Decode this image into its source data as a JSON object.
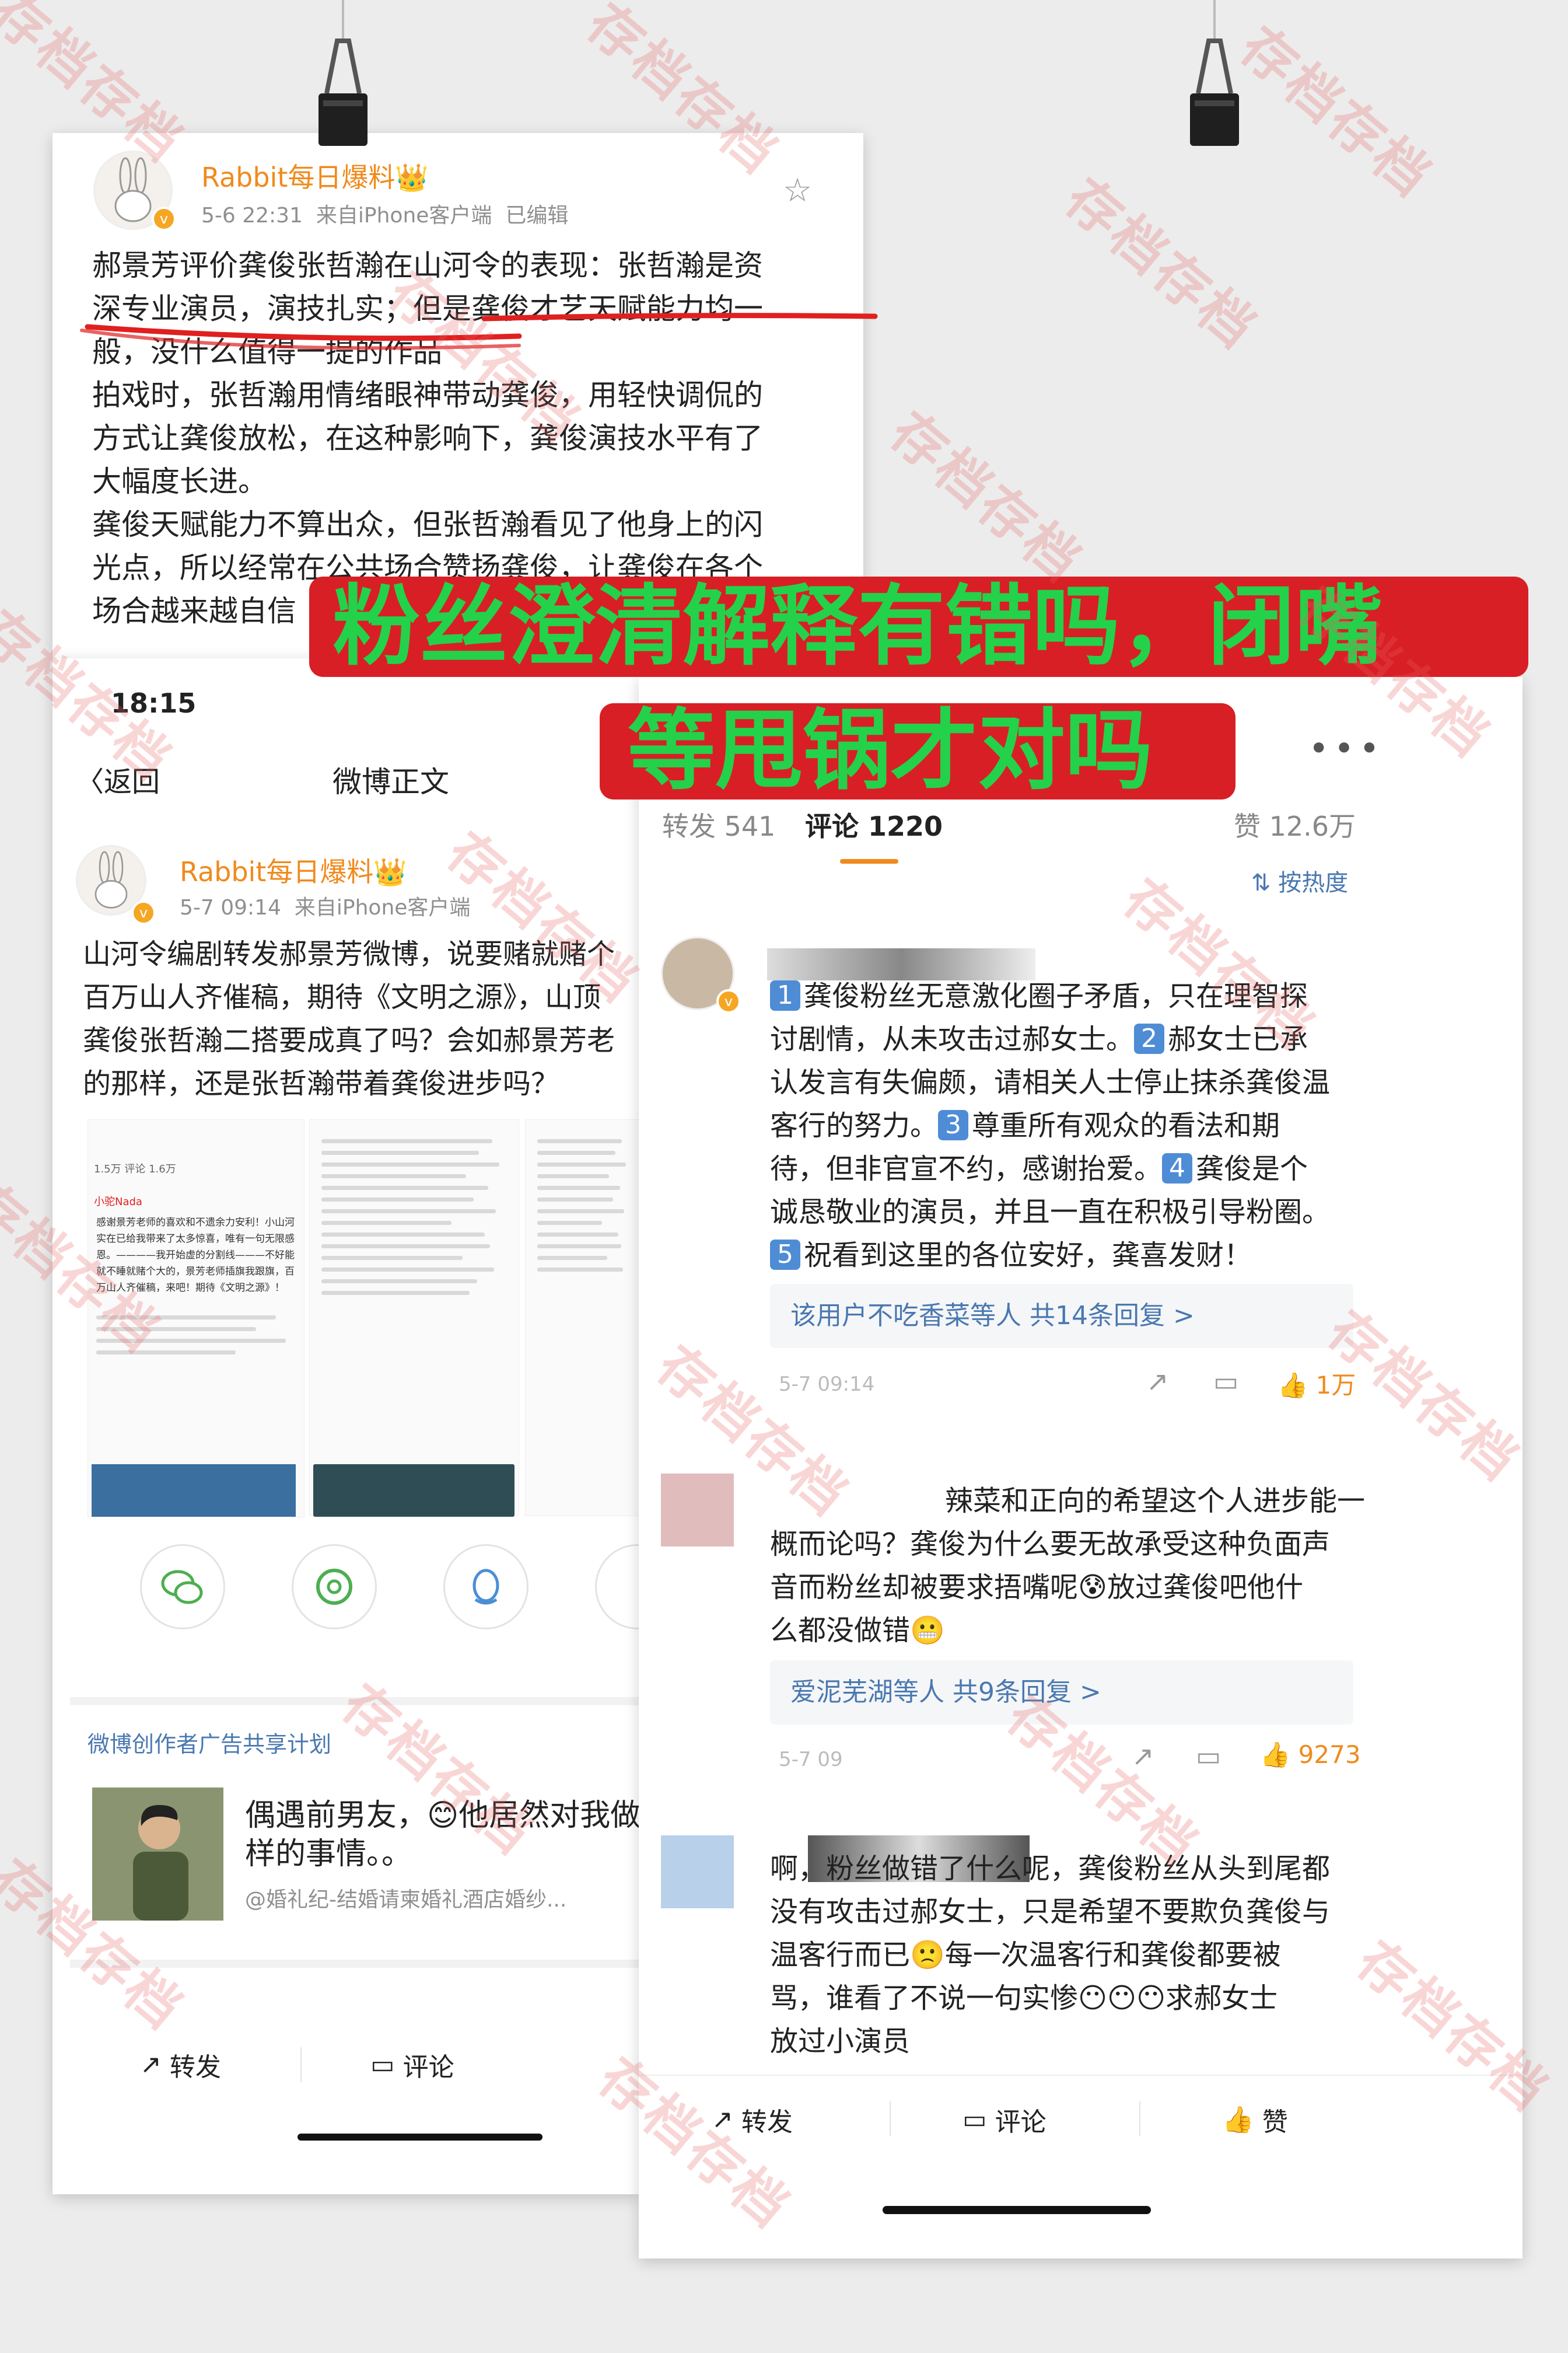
{
  "post1": {
    "user": "Rabbit每日爆料",
    "crown": "👑",
    "meta_time": "5-6 22:31",
    "meta_source": "来自iPhone客户端",
    "meta_edit": "已编辑",
    "body_lines": [
      "郝景芳评价龚俊张哲瀚在山河令的表现：张哲瀚是资",
      "深专业演员，演技扎实；但是龚俊才艺天赋能力均一",
      "般，没什么值得一提的作品",
      "拍戏时，张哲瀚用情绪眼神带动龚俊，用轻快调侃的",
      "方式让龚俊放松，在这种影响下，龚俊演技水平有了",
      "大幅度长进。",
      "龚俊天赋能力不算出众，但张哲瀚看见了他身上的闪",
      "光点，所以经常在公共场合赞扬龚俊，让龚俊在各个",
      "场合越来越自信"
    ]
  },
  "banner": {
    "line1": "粉丝澄清解释有错吗，闭嘴",
    "line2": "等甩锅才对吗"
  },
  "phone_left": {
    "status_time": "18:15",
    "back": "返回",
    "title": "微博正文",
    "user": "Rabbit每日爆料",
    "meta_time": "5-7 09:14",
    "meta_source": "来自iPhone客户端",
    "body_lines": [
      "山河令编剧转发郝景芳微博，说要赌就赌个",
      "百万山人齐催稿，期待《文明之源》，山顶",
      "龚俊张哲瀚二搭要成真了吗？会如郝景芳老",
      "的那样，还是张哲瀚带着龚俊进步吗？"
    ],
    "thumb_stats": "1.5万   评论 1.6万",
    "thumb_user": "小驼Nada",
    "thumb_text": "感谢景芳老师的喜欢和不遗余力安利！小山河实在已给我带来了太多惊喜，唯有一句无限感恩。————我开始虚的分割线———不好能就不睡就赌个大的，景芳老师插旗我跟旗，百万山人齐催稿，来吧！期待《文明之源》！",
    "share_icons": [
      "wechat-icon",
      "moments-icon",
      "qq-icon"
    ],
    "ad_label": "微博创作者广告共享计划",
    "ad_title": "偶遇前男友，😊他居然对我做",
    "ad_title2": "样的事情。。",
    "ad_source": "@婚礼纪-结婚请柬婚礼酒店婚纱...",
    "actions": [
      "转发",
      "评论"
    ]
  },
  "phone_right": {
    "tabs": [
      "转发 541",
      "评论 1220",
      "赞 12.6万"
    ],
    "sort": "按热度",
    "comment1": {
      "lines": [
        "龚俊粉丝无意激化圈子矛盾，只在理智探",
        "讨剧情，从未攻击过郝女士。",
        "郝女士已承",
        "认发言有失偏颇，请相关人士停止抹杀龚俊温",
        "客行的努力。",
        "尊重所有观众的看法和期",
        "待，但非官宣不约，感谢抬爱。",
        "龚俊是个",
        "诚恳敬业的演员，并且一直在积极引导粉圈。",
        "祝看到这里的各位安好，龚喜发财！"
      ],
      "nums": [
        "1",
        "2",
        "3",
        "4",
        "5"
      ],
      "reply_summary": "该用户不吃香菜等人  共14条回复 >",
      "time": "5-7 09:14",
      "likes": "1万"
    },
    "comment2": {
      "lines": [
        "辣菜和正向的希望这个人进步能一",
        "概而论吗？龚俊为什么要无故承受这种负面声",
        "音而粉丝却被要求捂嘴呢😰放过龚俊吧他什",
        "么都没做错😬"
      ],
      "reply_summary": "爱泥芜湖等人  共9条回复 >",
      "time": "5-7 09",
      "likes": "9273"
    },
    "comment3": {
      "lines": [
        "啊，粉丝做错了什么呢，龚俊粉丝从头到尾都",
        "没有攻击过郝女士，只是希望不要欺负龚俊与",
        "温客行而已🙁每一次温客行和龚俊都要被",
        "骂，谁看了不说一句实惨😶😶😶求郝女士",
        "放过小演员"
      ]
    },
    "actions": [
      "转发",
      "评论",
      "赞"
    ]
  },
  "watermark": "存档存档",
  "colors": {
    "banner_bg": "#d81f26",
    "banner_text": "#23d24a",
    "username": "#f08a1c",
    "link": "#4a78b0",
    "underline": "#e0201f"
  }
}
